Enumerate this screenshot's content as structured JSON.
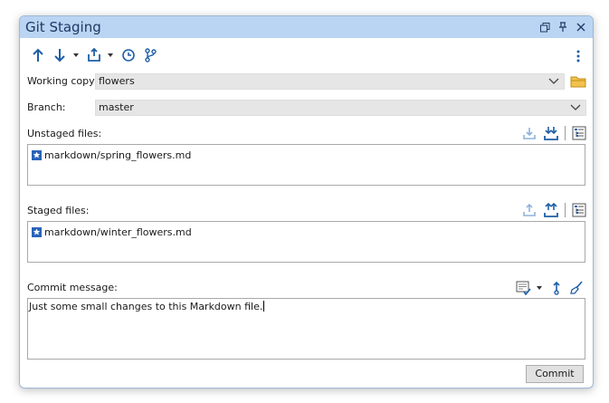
{
  "window": {
    "title": "Git Staging"
  },
  "working_copy": {
    "label": "Working copy:",
    "value": "flowers"
  },
  "branch": {
    "label": "Branch:",
    "value": "master"
  },
  "unstaged": {
    "label": "Unstaged files:",
    "files": [
      "markdown/spring_flowers.md"
    ]
  },
  "staged": {
    "label": "Staged files:",
    "files": [
      "markdown/winter_flowers.md"
    ]
  },
  "commit": {
    "label": "Commit message:",
    "message": "Just some small changes to this Markdown file.",
    "button": "Commit"
  },
  "colors": {
    "accent": "#1f5fa6",
    "titlebar": "#bad4f3",
    "file_icon": "#2a63b8"
  }
}
